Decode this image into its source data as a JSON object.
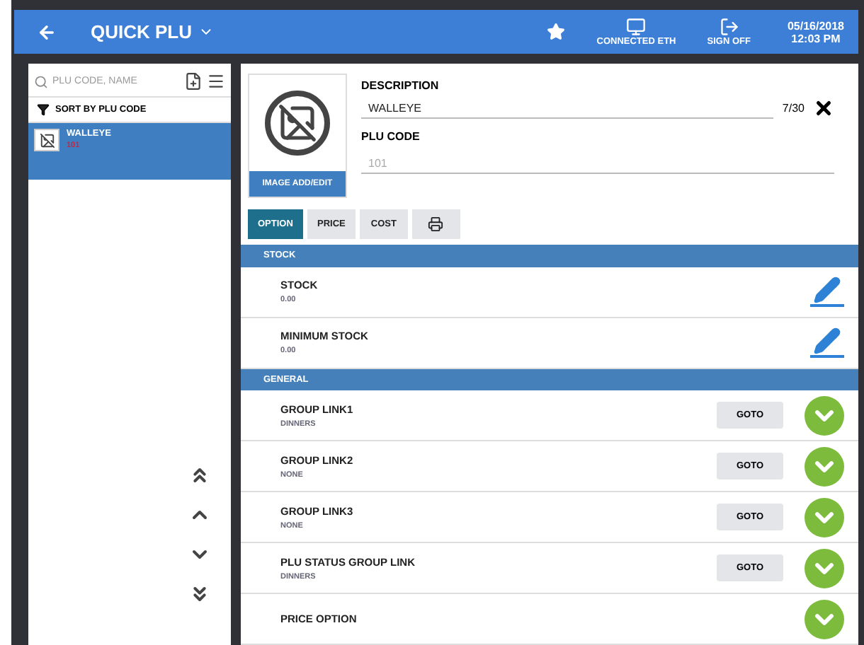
{
  "header": {
    "title": "QUICK PLU",
    "status": [
      {
        "kind": "network",
        "label": "CONNECTED ETH"
      },
      {
        "kind": "signoff",
        "label": "SIGN OFF"
      }
    ],
    "date": "05/16/2018",
    "time": "12:03 PM"
  },
  "sidebar": {
    "search": {
      "placeholder": "PLU CODE, NAME"
    },
    "sort": "SORT BY PLU CODE",
    "items": [
      {
        "name": "WALLEYE",
        "code": "101",
        "selected": true
      }
    ]
  },
  "detail": {
    "image_button": "IMAGE ADD/EDIT",
    "description_label": "DESCRIPTION",
    "description": "WALLEYE",
    "counter": "7/30",
    "plu_label": "PLU CODE",
    "plu_placeholder": "101"
  },
  "tabs": [
    {
      "kind": "text",
      "label": "OPTION",
      "selected": true
    },
    {
      "kind": "text",
      "label": "PRICE",
      "selected": false
    },
    {
      "kind": "text",
      "label": "COST",
      "selected": false
    },
    {
      "kind": "icon",
      "selected": false
    }
  ],
  "sections": [
    {
      "title": "STOCK",
      "rows": [
        {
          "kind": "edit",
          "name": "STOCK",
          "value": "0.00"
        },
        {
          "kind": "edit",
          "name": "MINIMUM STOCK",
          "value": "0.00"
        }
      ]
    },
    {
      "title": "GENERAL",
      "rows": [
        {
          "kind": "link",
          "name": "GROUP LINK1",
          "value": "DINNERS",
          "button": "GOTO"
        },
        {
          "kind": "link",
          "name": "GROUP LINK2",
          "value": "NONE",
          "button": "GOTO"
        },
        {
          "kind": "link",
          "name": "GROUP LINK3",
          "value": "NONE",
          "button": "GOTO"
        },
        {
          "kind": "link",
          "name": "PLU STATUS GROUP LINK",
          "value": "DINNERS",
          "button": "GOTO"
        },
        {
          "kind": "select",
          "name": "PRICE OPTION"
        }
      ]
    }
  ]
}
